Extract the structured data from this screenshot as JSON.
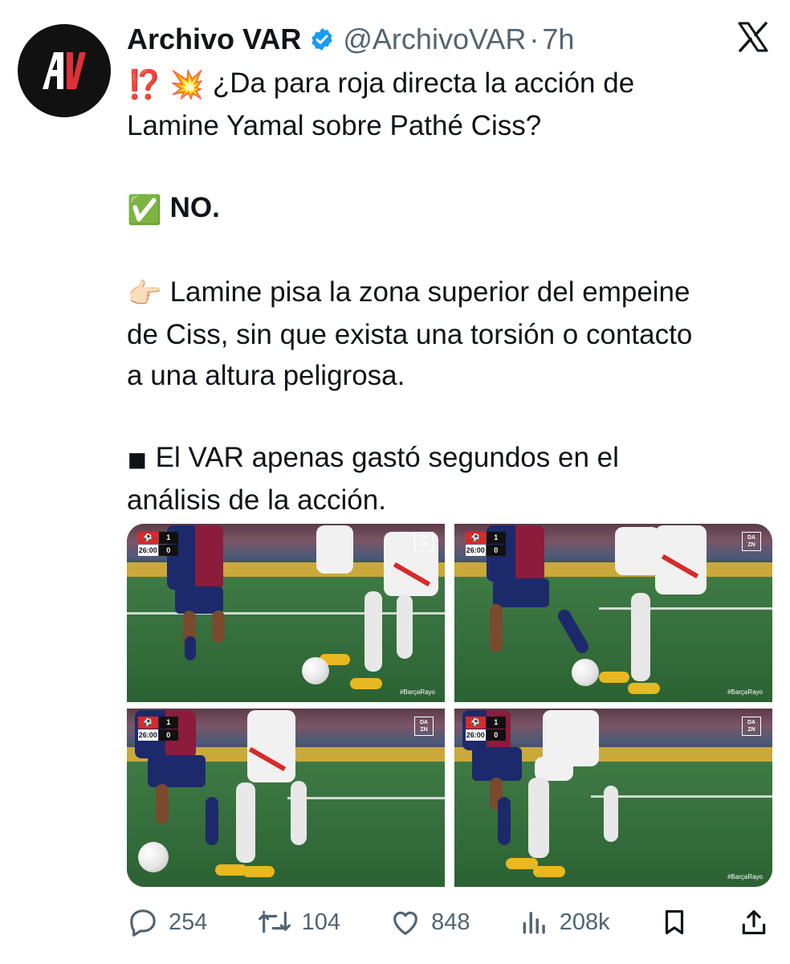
{
  "account": {
    "name": "Archivo VAR",
    "handle": "@ArchivoVAR",
    "separator": "·",
    "time": "7h",
    "avatar_text": "AV",
    "verified_icon": "verified-badge-icon"
  },
  "tweet": {
    "line1_emoji": "⁉️ 💥",
    "line1": "¿Da para roja directa la acción de",
    "line2": "Lamine Yamal sobre Pathé Ciss?",
    "answer_emoji": "✅",
    "answer": "NO.",
    "point_emoji": "👉🏻",
    "point_line1": "Lamine pisa la zona superior del empeine",
    "point_line2": "de Ciss, sin que exista una torsión o contacto",
    "point_line3": "a una altura peligrosa.",
    "var_emoji": "◾",
    "var_line1": "El VAR apenas gastó segundos en el",
    "var_line2": "análisis de la acción."
  },
  "media": {
    "frames": [
      {
        "clock": "26:00",
        "home_score": "1",
        "away_score": "0",
        "broadcaster": [
          "DA",
          "ZN"
        ],
        "hashtag": "#BarçaRayo"
      },
      {
        "clock": "26:00",
        "home_score": "1",
        "away_score": "0",
        "broadcaster": [
          "DA",
          "ZN"
        ],
        "hashtag": "#BarçaRayo"
      },
      {
        "clock": "26:00",
        "home_score": "1",
        "away_score": "0",
        "broadcaster": [
          "DA",
          "ZN"
        ],
        "hashtag": ""
      },
      {
        "clock": "26:00",
        "home_score": "1",
        "away_score": "0",
        "broadcaster": [
          "DA",
          "ZN"
        ],
        "hashtag": "#BarçaRayo"
      }
    ]
  },
  "actions": {
    "replies": "254",
    "reposts": "104",
    "likes": "848",
    "views": "208k",
    "icons": [
      "reply-icon",
      "repost-icon",
      "like-icon",
      "views-icon",
      "bookmark-icon",
      "share-icon"
    ]
  },
  "colors": {
    "text": "#0f1419",
    "secondary": "#536471",
    "verified": "#1d9bf0",
    "avatar_bg": "#111111",
    "avatar_red": "#e0303a"
  }
}
